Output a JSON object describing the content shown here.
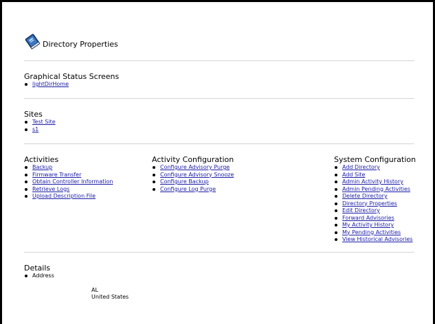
{
  "header": {
    "title": "Directory Properties"
  },
  "status_screens": {
    "title": "Graphical Status Screens",
    "links": [
      "lightDirHome"
    ]
  },
  "sites": {
    "title": "Sites",
    "links": [
      "Test Site",
      "s1"
    ]
  },
  "activities": {
    "title": "Activities",
    "links": [
      "Backup",
      "Firmware Transfer",
      "Obtain Controller Information",
      "Retrieve Logs",
      "Upload Description File"
    ]
  },
  "activity_config": {
    "title": "Activity Configuration",
    "links": [
      "Configure Advisory Purge",
      "Configure Advisory Snooze",
      "Configure Backup",
      "Configure Log Purge"
    ]
  },
  "system_config": {
    "title": "System Configuration",
    "links": [
      "Add Directory",
      "Add Site",
      "Admin Activity History",
      "Admin Pending Activities",
      "Delete Directory",
      "Directory Properties",
      "Edit Directory",
      "Forward Advisories",
      "My Activity History",
      "My Pending Activities",
      "View Historical Advisories"
    ]
  },
  "details": {
    "title": "Details",
    "items": [
      "Address"
    ],
    "address_lines": [
      "AL",
      "United States"
    ]
  },
  "colors": {
    "link": "#1a1aa6",
    "rule": "#d4d4d4",
    "frame": "#000000"
  }
}
